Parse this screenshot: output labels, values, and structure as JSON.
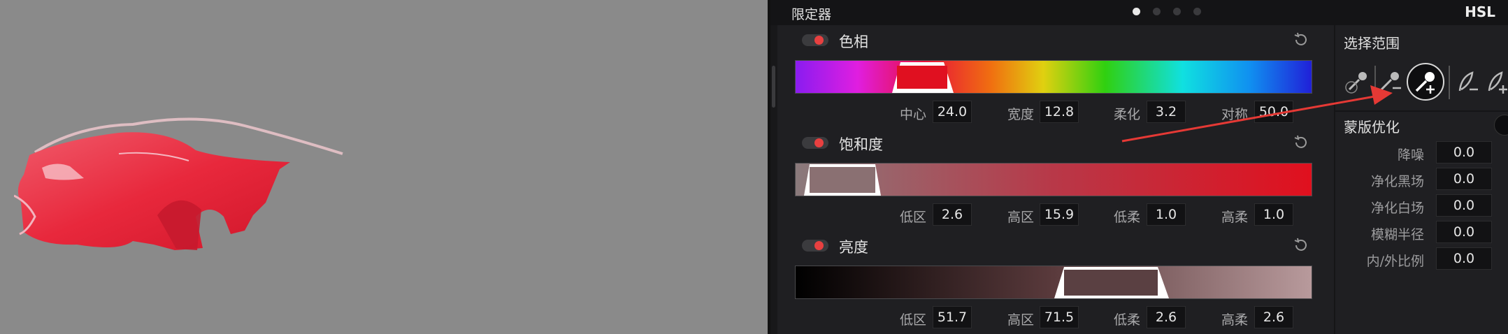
{
  "panel": {
    "title": "限定器",
    "mode": "HSL",
    "page_dots": 4,
    "active_dot": 0
  },
  "hue": {
    "title": "色相",
    "params": [
      {
        "label": "中心",
        "value": "24.0"
      },
      {
        "label": "宽度",
        "value": "12.8"
      },
      {
        "label": "柔化",
        "value": "3.2"
      },
      {
        "label": "对称",
        "value": "50.0"
      }
    ]
  },
  "saturation": {
    "title": "饱和度",
    "params": [
      {
        "label": "低区",
        "value": "2.6"
      },
      {
        "label": "高区",
        "value": "15.9"
      },
      {
        "label": "低柔",
        "value": "1.0"
      },
      {
        "label": "高柔",
        "value": "1.0"
      }
    ]
  },
  "luminance": {
    "title": "亮度",
    "params": [
      {
        "label": "低区",
        "value": "51.7"
      },
      {
        "label": "高区",
        "value": "71.5"
      },
      {
        "label": "低柔",
        "value": "2.6"
      },
      {
        "label": "高柔",
        "value": "2.6"
      }
    ]
  },
  "selection": {
    "title": "选择范围",
    "tools": [
      "picker-icon",
      "picker-minus-icon",
      "picker-plus-icon",
      "feather-minus-icon",
      "feather-plus-icon"
    ],
    "active_tool": "picker-plus-icon"
  },
  "matte": {
    "title": "蒙版优化",
    "rows": [
      {
        "label": "降噪",
        "value": "0.0"
      },
      {
        "label": "净化黑场",
        "value": "0.0"
      },
      {
        "label": "净化白场",
        "value": "0.0"
      },
      {
        "label": "模糊半径",
        "value": "0.0"
      },
      {
        "label": "内/外比例",
        "value": "0.0"
      }
    ]
  },
  "colors": {
    "toggle_on": "#e84040",
    "arrow": "#e53935",
    "viewer_bg": "#8a8a8a"
  }
}
